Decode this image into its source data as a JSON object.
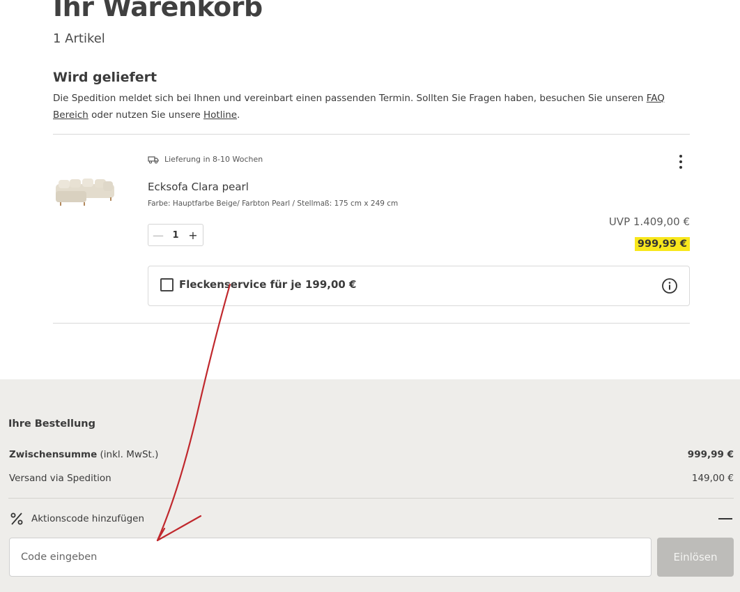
{
  "page": {
    "title": "Ihr Warenkorb",
    "article_count": "1 Artikel"
  },
  "delivery": {
    "heading": "Wird geliefert",
    "text_1": "Die Spedition meldet sich bei Ihnen und vereinbart einen passenden Termin. Sollten Sie Fragen haben, besuchen Sie unseren ",
    "faq_link": "FAQ Bereich",
    "text_2": " oder nutzen Sie unsere ",
    "hotline_link": "Hotline",
    "text_3": "."
  },
  "item": {
    "delivery_time": "Lieferung in 8-10 Wochen",
    "delivery_icon": "truck-icon",
    "name": "Ecksofa Clara pearl",
    "attributes": "Farbe: Hauptfarbe Beige/ Farbton Pearl / Stellmaß: 175 cm x 249 cm",
    "quantity": "1",
    "minus_symbol": "—",
    "plus_symbol": "+",
    "uvp": "UVP 1.409,00 €",
    "price": "999,99 €",
    "price_highlight_color": "#f8e71c"
  },
  "service": {
    "label": "Fleckenservice für je 199,00 €",
    "checked": false,
    "icon": "info-icon"
  },
  "summary": {
    "heading": "Ihre Bestellung",
    "subtotal_label": "Zwischensumme",
    "subtotal_note": " (inkl. MwSt.)",
    "subtotal_value": "999,99 €",
    "shipping_label": "Versand via Spedition",
    "shipping_value": "149,00 €",
    "promo_label": "Aktionscode hinzufügen",
    "promo_icon": "percent-icon",
    "code_placeholder": "Code eingeben",
    "redeem_label": "Einlösen"
  },
  "annotation": {
    "color": "#c0282d"
  }
}
